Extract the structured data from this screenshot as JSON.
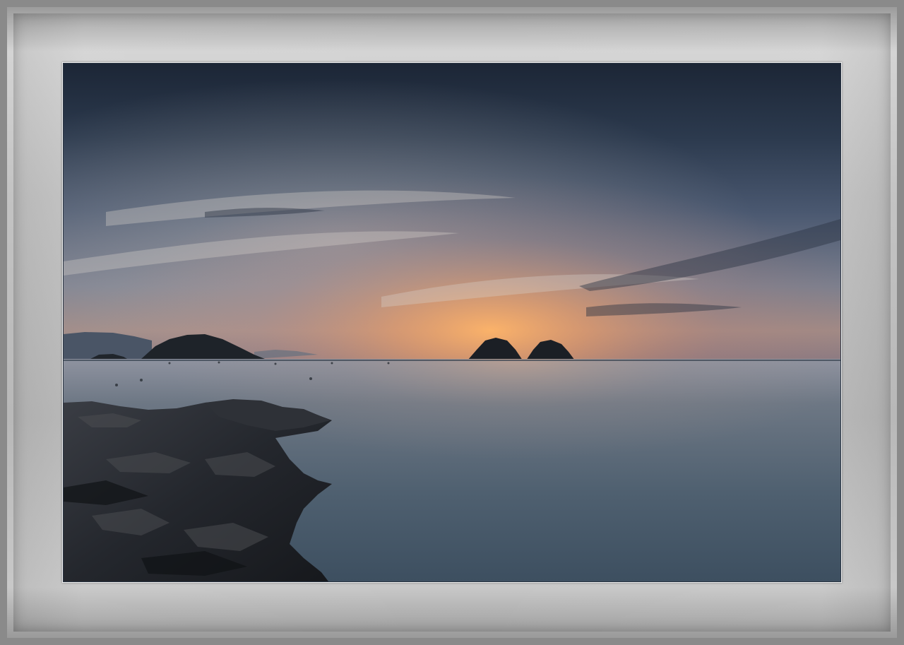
{
  "image": {
    "subject": "seascape-at-dusk",
    "colors": {
      "sky_top": "#1e2837",
      "sky_mid": "#4a5a70",
      "horizon_glow": "#f2a35c",
      "water": "#4d5f6d",
      "rocks": "#1c1f24",
      "frame": "#bdbdbd"
    }
  }
}
